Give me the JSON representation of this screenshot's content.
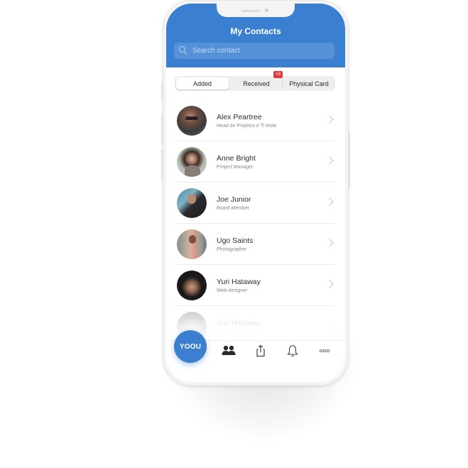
{
  "header": {
    "title": "My Contacts",
    "search": {
      "placeholder": "Search contact",
      "value": "",
      "icon": "search-icon"
    }
  },
  "tabs": [
    {
      "label": "Added",
      "active": true
    },
    {
      "label": "Received",
      "active": false,
      "badge": "+3"
    },
    {
      "label": "Physical Card",
      "active": false
    }
  ],
  "contacts": [
    {
      "name": "Alex Peartree",
      "role": "Head de Projetos e Ti teste"
    },
    {
      "name": "Anne Bright",
      "role": "Project Manager"
    },
    {
      "name": "Joe Junior",
      "role": "Board Member"
    },
    {
      "name": "Ugo Saints",
      "role": "Photographer"
    },
    {
      "name": "Yuri Hataway",
      "role": "Web-designer"
    },
    {
      "name": "Yuri Hataway",
      "role": "Web-designer"
    }
  ],
  "tabbar": {
    "logo_label": "YOOU",
    "items": [
      {
        "icon": "contacts-icon"
      },
      {
        "icon": "share-icon"
      },
      {
        "icon": "bell-icon"
      },
      {
        "icon": "more-icon"
      }
    ]
  },
  "colors": {
    "accent": "#3a7fd0",
    "badge": "#e03a3f"
  }
}
